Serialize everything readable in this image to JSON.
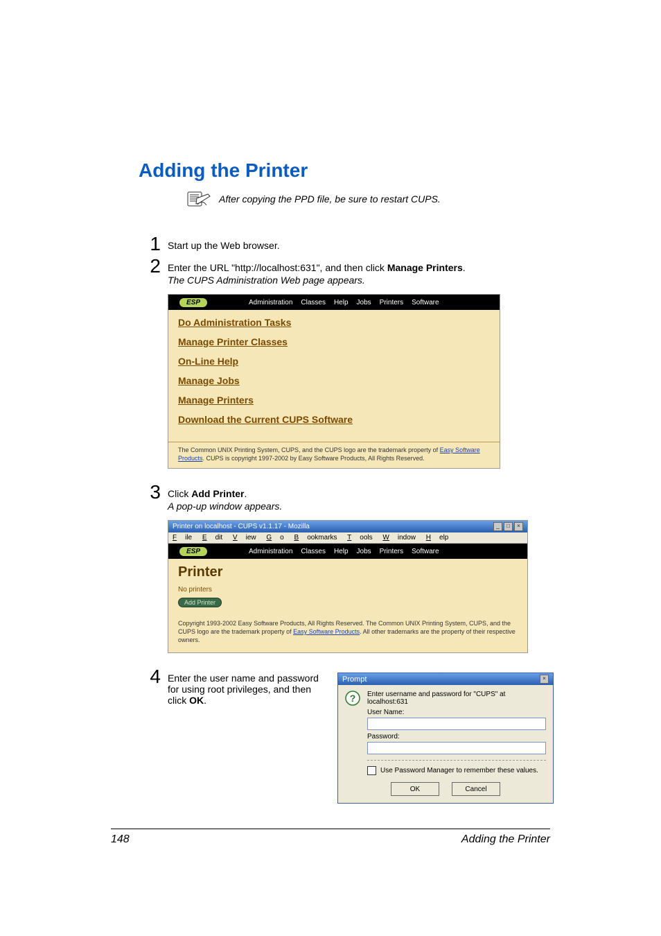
{
  "heading": "Adding the Printer",
  "note": "After copying the PPD file, be sure to restart CUPS.",
  "steps": {
    "s1": {
      "num": "1",
      "text": "Start up the Web browser."
    },
    "s2": {
      "num": "2",
      "pre": "Enter the URL \"http://localhost:631\", and then click ",
      "bold": "Manage Printers",
      "post": ".",
      "sub": "The CUPS Administration Web page appears."
    },
    "s3": {
      "num": "3",
      "pre": "Click ",
      "bold": "Add Printer",
      "post": ".",
      "sub": "A pop-up window appears."
    },
    "s4": {
      "num": "4",
      "pre": "Enter the user name and password for using root privileges, and then click ",
      "bold": "OK",
      "post": "."
    }
  },
  "cups1": {
    "logo": "ESP",
    "nav": [
      "Administration",
      "Classes",
      "Help",
      "Jobs",
      "Printers",
      "Software"
    ],
    "links": {
      "admin": "Do Administration Tasks",
      "classes": "Manage Printer Classes",
      "help": "On-Line Help",
      "jobs": "Manage  Jobs",
      "printers": "Manage Printers",
      "download": "Download the Current CUPS Software"
    },
    "footer_a": "The Common UNIX Printing System, CUPS, and the CUPS logo are the trademark property of ",
    "footer_link": "Easy Software Products",
    "footer_b": ". CUPS is copyright 1997-2002 by Easy Software Products, All Rights Reserved."
  },
  "cups2": {
    "win_title": "Printer on localhost - CUPS v1.1.17 - Mozilla",
    "menu": {
      "file": "File",
      "edit": "Edit",
      "view": "View",
      "go": "Go",
      "bookmarks": "Bookmarks",
      "tools": "Tools",
      "window": "Window",
      "help": "Help"
    },
    "logo": "ESP",
    "nav": [
      "Administration",
      "Classes",
      "Help",
      "Jobs",
      "Printers",
      "Software"
    ],
    "heading": "Printer",
    "no_printers": "No printers",
    "add_btn": "Add Printer",
    "footer_a": "Copyright 1993-2002 Easy Software Products, All Rights Reserved. The Common UNIX Printing System, CUPS, and the CUPS logo are the trademark property of ",
    "footer_link": "Easy Software Products",
    "footer_b": ". All other trademarks are the property of their respective owners."
  },
  "prompt": {
    "title": "Prompt",
    "msg": "Enter username and password for \"CUPS\" at localhost:631",
    "user_label": "User Name:",
    "pass_label": "Password:",
    "chk_label": "Use Password Manager to remember these values.",
    "ok": "OK",
    "cancel": "Cancel"
  },
  "footer": {
    "page_num": "148",
    "title": "Adding the Printer"
  }
}
